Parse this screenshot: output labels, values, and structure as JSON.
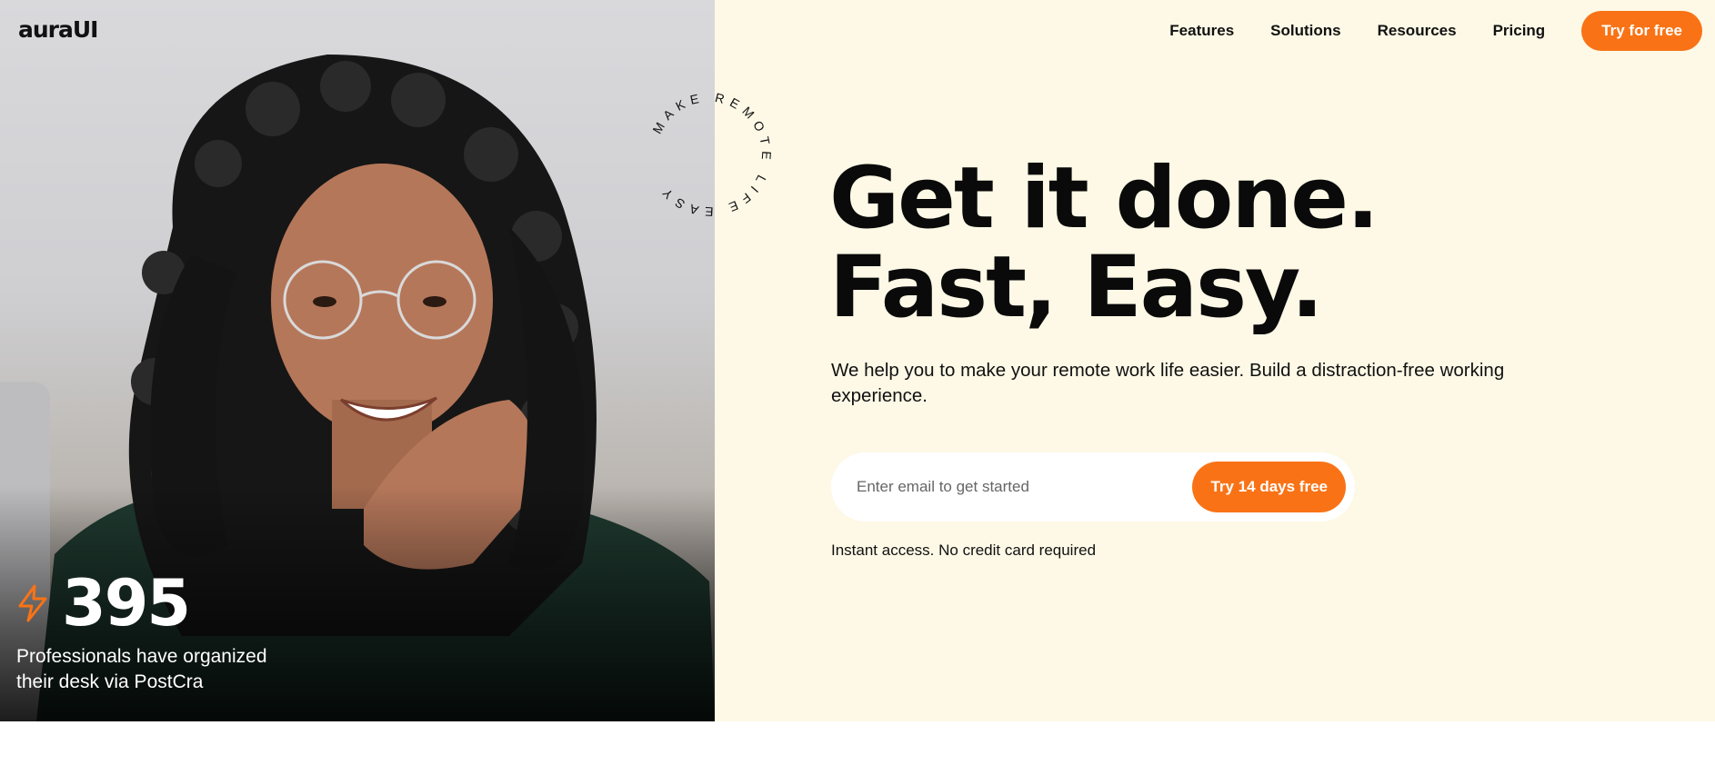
{
  "brand": {
    "logo_text": "auraUI",
    "accent_color": "#f97316",
    "hero_bg": "#fdf9e6"
  },
  "nav": {
    "links": [
      "Features",
      "Solutions",
      "Resources",
      "Pricing"
    ],
    "cta_label": "Try for free"
  },
  "badge": {
    "circular_text": "MAKE REMOTE LIFE EASY"
  },
  "hero": {
    "headline_line1": "Get it done.",
    "headline_line2": "Fast, Easy.",
    "subtext": "We help you to make your remote work life easier. Build a distraction-free working experience.",
    "email_placeholder": "Enter email to get started",
    "signup_button": "Try 14 days free",
    "note": "Instant access. No credit card required"
  },
  "stat": {
    "icon": "lightning-bolt-icon",
    "number": "395",
    "caption": "Professionals have organized their desk via PostCra"
  }
}
